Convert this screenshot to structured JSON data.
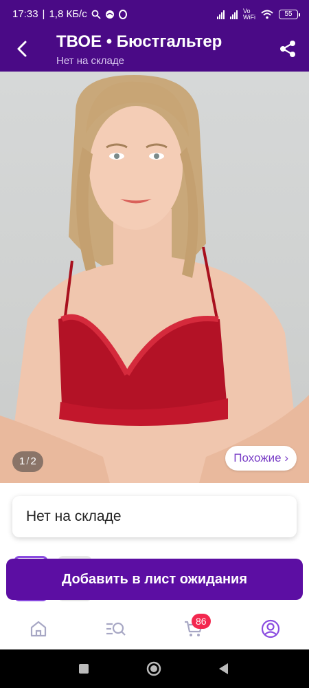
{
  "status_bar": {
    "time": "17:33",
    "network_speed": "1,8 КБ/с",
    "volte": "Vo",
    "wifi": "WiFi",
    "battery": "55"
  },
  "header": {
    "title": "ТВОЕ • Бюстгальтер",
    "subtitle": "Нет на складе"
  },
  "gallery": {
    "current": "1",
    "separator": "/",
    "total": "2",
    "similar_label": "Похожие ›"
  },
  "stock": {
    "label": "Нет на складе"
  },
  "cta": {
    "label": "Добавить в лист ожидания"
  },
  "bottom_nav": {
    "items": [
      "home-icon",
      "catalog-search-icon",
      "cart-icon",
      "profile-icon"
    ],
    "cart_badge": "86",
    "accent": "#8a4be0"
  },
  "colors": {
    "brand": "#4a0a86",
    "cta": "#5c0ea3",
    "badge": "#f3284f"
  }
}
